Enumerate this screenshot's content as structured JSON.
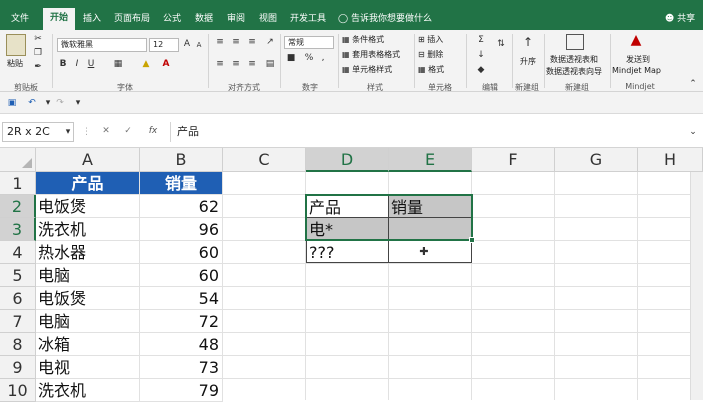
{
  "tabs": [
    "文件",
    "开始",
    "插入",
    "页面布局",
    "公式",
    "数据",
    "审阅",
    "视图",
    "开发工具"
  ],
  "tellme": "告诉我你想要做什么",
  "share": "共享",
  "ribbon": {
    "paste": "粘贴",
    "clipboard": "剪贴板",
    "font_name": "微软雅黑",
    "font_size": "12",
    "font_group": "字体",
    "align_group": "对齐方式",
    "number_format": "常规",
    "number_group": "数字",
    "cond_format": "条件格式",
    "table_format": "套用表格格式",
    "cell_style": "单元格样式",
    "style_group": "样式",
    "insert": "插入",
    "delete": "删除",
    "format": "格式",
    "cells_group": "单元格",
    "edit_group": "编辑",
    "sort": "升序",
    "new_group": "新建组",
    "pivot1": "数据透视表和",
    "pivot2": "数据透视表向导",
    "mindjet1": "发送到",
    "mindjet2": "Mindjet Map",
    "mindjet_group": "Mindjet"
  },
  "namebox": "2R x 2C",
  "formula": "产品",
  "fx": "fx",
  "columns": [
    "A",
    "B",
    "C",
    "D",
    "E",
    "F",
    "G",
    "H"
  ],
  "rows": [
    "1",
    "2",
    "3",
    "4",
    "5",
    "6",
    "7",
    "8",
    "9",
    "10"
  ],
  "table_header": {
    "a": "产品",
    "b": "销量"
  },
  "table_rows": [
    {
      "a": "电饭煲",
      "b": "62"
    },
    {
      "a": "洗衣机",
      "b": "96"
    },
    {
      "a": "热水器",
      "b": "60"
    },
    {
      "a": "电脑",
      "b": "60"
    },
    {
      "a": "电饭煲",
      "b": "54"
    },
    {
      "a": "电脑",
      "b": "72"
    },
    {
      "a": "冰箱",
      "b": "48"
    },
    {
      "a": "电视",
      "b": "73"
    },
    {
      "a": "洗衣机",
      "b": "79"
    }
  ],
  "criteria": {
    "d1": "产品",
    "e1": "销量",
    "d2": "电*",
    "e2": "",
    "d3": "???",
    "e3": ""
  }
}
